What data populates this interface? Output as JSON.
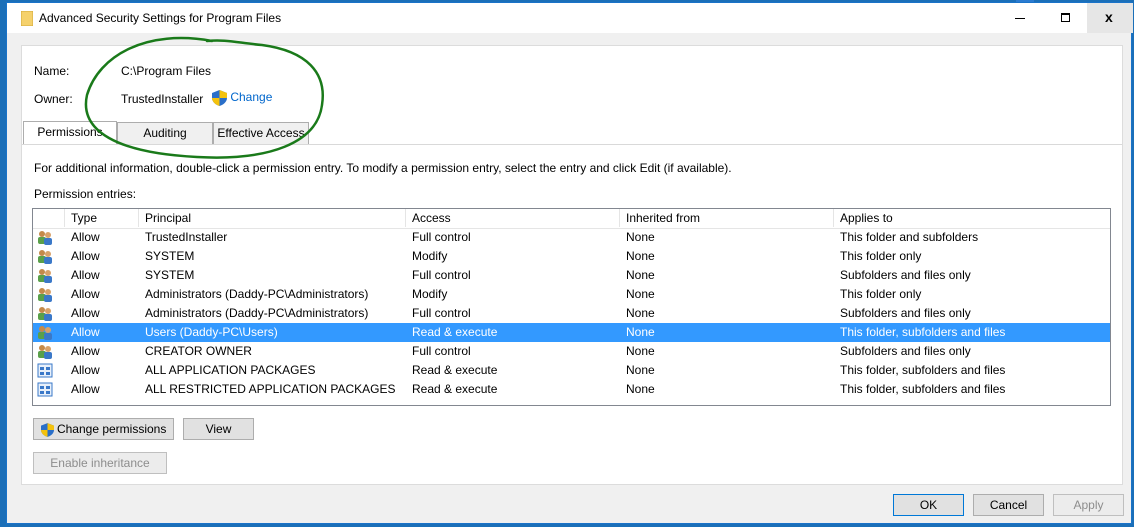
{
  "window": {
    "title": "Advanced Security Settings for Program Files",
    "controls": {
      "minimize": "minimize",
      "maximize": "maximize",
      "close": "x"
    }
  },
  "info": {
    "name_label": "Name:",
    "name_value": "C:\\Program Files",
    "owner_label": "Owner:",
    "owner_value": "TrustedInstaller",
    "owner_change": "Change"
  },
  "tabs": [
    {
      "label": "Permissions",
      "active": true
    },
    {
      "label": "Auditing",
      "active": false
    },
    {
      "label": "Effective Access",
      "active": false
    }
  ],
  "description": "For additional information, double-click a permission entry. To modify a permission entry, select the entry and click Edit (if available).",
  "entries_label": "Permission entries:",
  "table": {
    "columns": [
      "Type",
      "Principal",
      "Access",
      "Inherited from",
      "Applies to"
    ],
    "rows": [
      {
        "icon": "users-icon",
        "type": "Allow",
        "principal": "TrustedInstaller",
        "access": "Full control",
        "inherited": "None",
        "applies": "This folder and subfolders",
        "selected": false
      },
      {
        "icon": "users-icon",
        "type": "Allow",
        "principal": "SYSTEM",
        "access": "Modify",
        "inherited": "None",
        "applies": "This folder only",
        "selected": false
      },
      {
        "icon": "users-icon",
        "type": "Allow",
        "principal": "SYSTEM",
        "access": "Full control",
        "inherited": "None",
        "applies": "Subfolders and files only",
        "selected": false
      },
      {
        "icon": "users-icon",
        "type": "Allow",
        "principal": "Administrators (Daddy-PC\\Administrators)",
        "access": "Modify",
        "inherited": "None",
        "applies": "This folder only",
        "selected": false
      },
      {
        "icon": "users-icon",
        "type": "Allow",
        "principal": "Administrators (Daddy-PC\\Administrators)",
        "access": "Full control",
        "inherited": "None",
        "applies": "Subfolders and files only",
        "selected": false
      },
      {
        "icon": "users-icon",
        "type": "Allow",
        "principal": "Users (Daddy-PC\\Users)",
        "access": "Read & execute",
        "inherited": "None",
        "applies": "This folder, subfolders and files",
        "selected": true
      },
      {
        "icon": "users-icon",
        "type": "Allow",
        "principal": "CREATOR OWNER",
        "access": "Full control",
        "inherited": "None",
        "applies": "Subfolders and files only",
        "selected": false
      },
      {
        "icon": "app-packages-icon",
        "type": "Allow",
        "principal": "ALL APPLICATION PACKAGES",
        "access": "Read & execute",
        "inherited": "None",
        "applies": "This folder, subfolders and files",
        "selected": false
      },
      {
        "icon": "app-packages-icon",
        "type": "Allow",
        "principal": "ALL RESTRICTED APPLICATION PACKAGES",
        "access": "Read & execute",
        "inherited": "None",
        "applies": "This folder, subfolders and files",
        "selected": false
      }
    ]
  },
  "buttons": {
    "change_permissions": "Change permissions",
    "view": "View",
    "enable_inheritance": "Enable inheritance",
    "ok": "OK",
    "cancel": "Cancel",
    "apply": "Apply"
  },
  "colors": {
    "selection": "#3399ff",
    "link": "#0066cc",
    "annotation": "#1a7a1a"
  }
}
